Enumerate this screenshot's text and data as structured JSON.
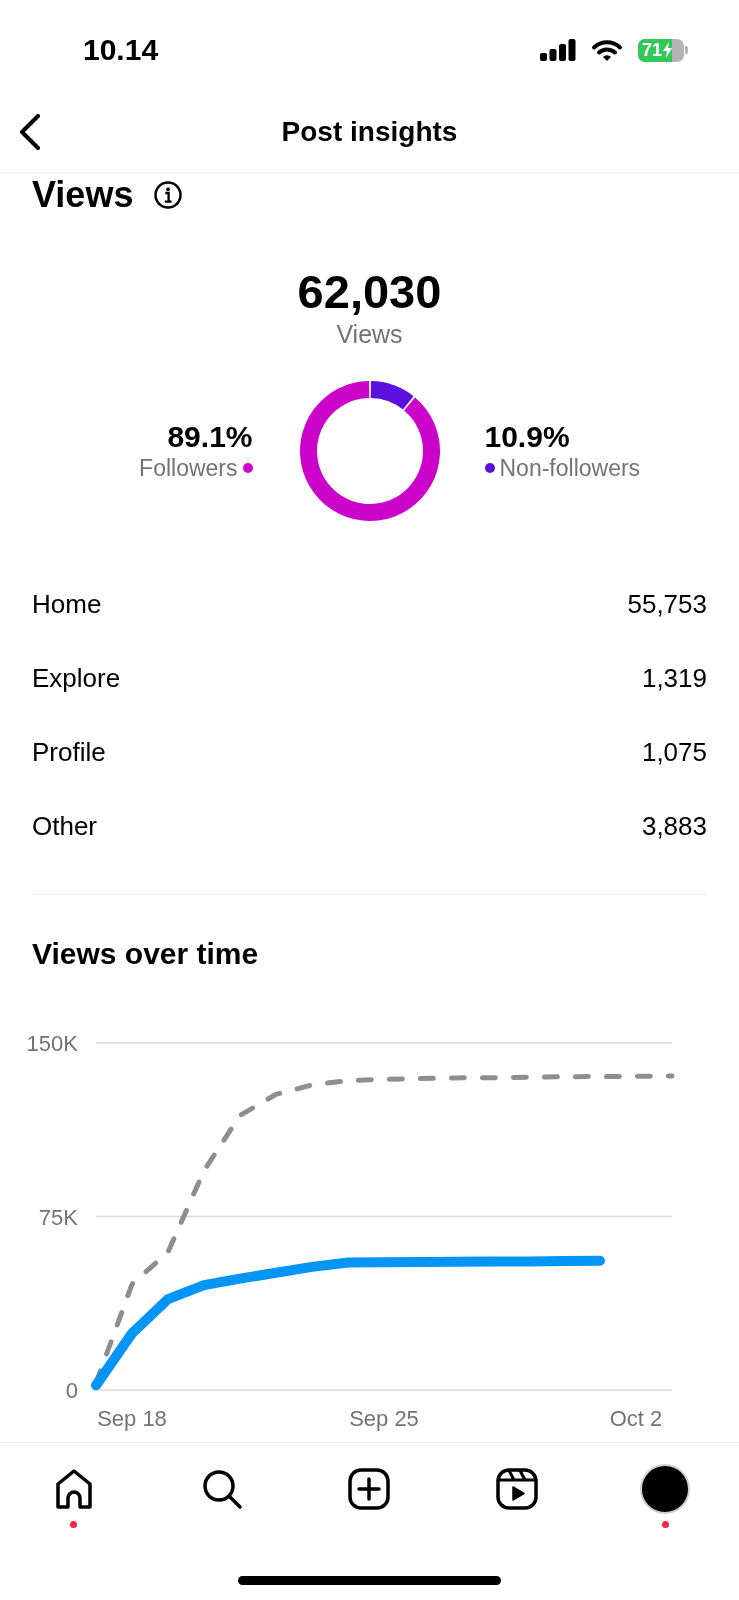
{
  "status_bar": {
    "time": "10.14",
    "battery": "71",
    "charging": true
  },
  "header": {
    "title": "Post insights"
  },
  "views": {
    "heading": "Views",
    "total": "62,030",
    "total_label": "Views",
    "chart_data": {
      "type": "donut",
      "categories": [
        "Followers",
        "Non-followers"
      ],
      "values": [
        89.1,
        10.9
      ],
      "value_labels": [
        "89.1%",
        "10.9%"
      ],
      "colors": [
        "#cc04c9",
        "#5b10e0"
      ]
    },
    "breakdown": [
      {
        "label": "Home",
        "value": "55,753"
      },
      {
        "label": "Explore",
        "value": "1,319"
      },
      {
        "label": "Profile",
        "value": "1,075"
      },
      {
        "label": "Other",
        "value": "3,883"
      }
    ]
  },
  "views_over_time": {
    "heading": "Views over time",
    "chart_data": {
      "type": "line",
      "categories": [
        null,
        "Sep 18",
        null,
        null,
        null,
        null,
        null,
        null,
        "Sep 25",
        null,
        null,
        null,
        null,
        null,
        null,
        "Oct 2",
        null
      ],
      "ylim": [
        0,
        150000
      ],
      "yticks": [
        {
          "value": 0,
          "label": "0"
        },
        {
          "value": 75000,
          "label": "75K"
        },
        {
          "value": 150000,
          "label": "150K"
        }
      ],
      "series": [
        {
          "color": "#8e8e8e",
          "line_style": "dashed",
          "values": [
            3000,
            45700,
            59600,
            94800,
            118700,
            127800,
            131900,
            133800,
            134300,
            134600,
            134900,
            135000,
            135200,
            135400,
            135500,
            135600,
            135700
          ]
        },
        {
          "color": "#0095f6",
          "line_style": "solid",
          "values": [
            2000,
            24500,
            39300,
            45300,
            48100,
            50700,
            53200,
            55100,
            55200,
            55300,
            55400,
            55500,
            55600,
            55800,
            55900,
            null,
            null
          ]
        }
      ]
    }
  },
  "bottom_nav": [
    {
      "kind": "home",
      "dot": true
    },
    {
      "kind": "search",
      "dot": false
    },
    {
      "kind": "create",
      "dot": false
    },
    {
      "kind": "reels",
      "dot": false
    },
    {
      "kind": "profile",
      "dot": true
    }
  ]
}
